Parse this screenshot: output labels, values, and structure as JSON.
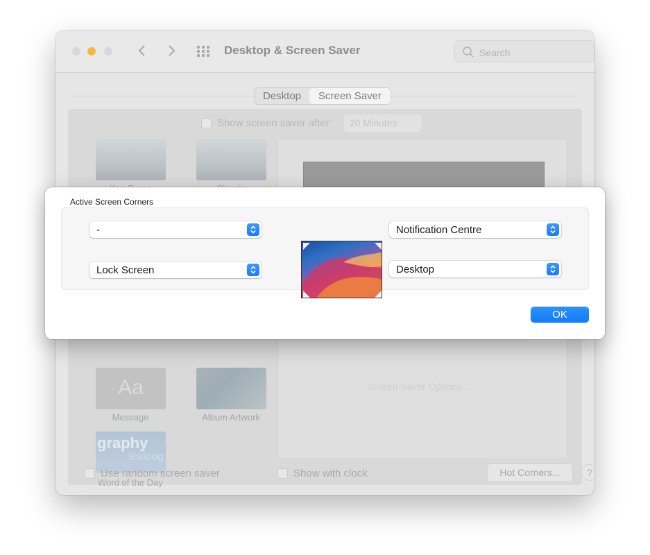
{
  "window": {
    "title": "Desktop & Screen Saver",
    "search_placeholder": "Search",
    "tabs": [
      "Desktop",
      "Screen Saver"
    ],
    "active_tab": "Screen Saver",
    "show_after_label": "Show screen saver after",
    "show_after_value": "20 Minutes",
    "savers": [
      {
        "label": "Ken Burns"
      },
      {
        "label": "Classic"
      },
      {
        "label": "Message",
        "glyph": "Aa"
      },
      {
        "label": "Album Artwork"
      },
      {
        "label": "Word of the Day",
        "glyph_main": "graphy",
        "glyph_sub": "lexicog"
      }
    ],
    "options_label": "Screen Saver Options...",
    "random_label": "Use random screen saver",
    "clock_label": "Show with clock",
    "hot_corners_label": "Hot Corners...",
    "help_label": "?"
  },
  "sheet": {
    "title": "Active Screen Corners",
    "top_left": "-",
    "bottom_left": "Lock Screen",
    "top_right": "Notification Centre",
    "bottom_right": "Desktop",
    "ok_label": "OK"
  },
  "colors": {
    "accent": "#1b7aff",
    "traffic_yellow": "#f6b740"
  }
}
